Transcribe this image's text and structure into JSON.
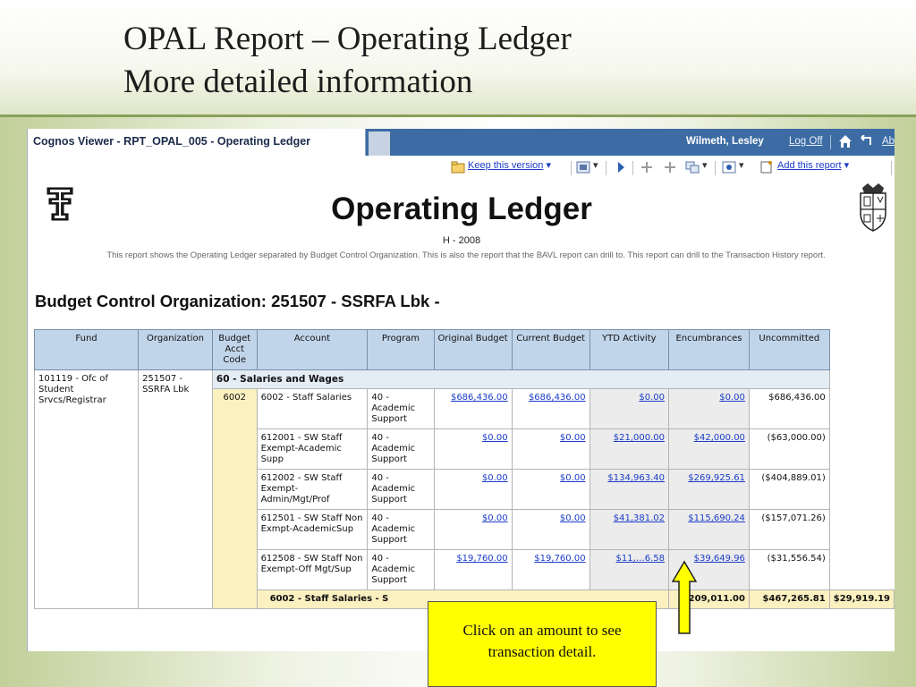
{
  "slide": {
    "title_line1": "OPAL Report – Operating Ledger",
    "title_line2": "More detailed information"
  },
  "viewer": {
    "tab_title": "Cognos Viewer - RPT_OPAL_005 - Operating Ledger",
    "user": "Wilmeth, Lesley",
    "logoff": "Log Off",
    "about_partial": "Ab",
    "toolbar": {
      "keep_version": "Keep this version",
      "add_report": "Add this report"
    }
  },
  "report": {
    "title": "Operating Ledger",
    "subtitle": "H - 2008",
    "description": "This report shows the Operating Ledger separated by Budget Control Organization.  This is also the report that the BAVL report can drill to.  This report can drill to the Transaction History report.",
    "bco_heading": "Budget Control Organization: 251507 - SSRFA Lbk -"
  },
  "table": {
    "headers": {
      "fund": "Fund",
      "organization": "Organization",
      "budget_acct_code": "Budget Acct Code",
      "account": "Account",
      "program": "Program",
      "original_budget": "Original Budget",
      "current_budget": "Current Budget",
      "ytd_activity": "YTD Activity",
      "encumbrances": "Encumbrances",
      "uncommitted": "Uncommitted"
    },
    "fund": "101119 - Ofc of Student Srvcs/Registrar",
    "organization": "251507 - SSRFA Lbk",
    "group_label": "60 - Salaries and Wages",
    "budget_acct_code": "6002",
    "rows": [
      {
        "account": "6002 - Staff Salaries",
        "program": "40 - Academic Support",
        "original": "$686,436.00",
        "current": "$686,436.00",
        "ytd": "$0.00",
        "enc": "$0.00",
        "uncommitted": "$686,436.00"
      },
      {
        "account": "612001 - SW Staff Exempt-Academic Supp",
        "program": "40 - Academic Support",
        "original": "$0.00",
        "current": "$0.00",
        "ytd": "$21,000.00",
        "enc": "$42,000.00",
        "uncommitted": "($63,000.00)"
      },
      {
        "account": "612002 - SW Staff Exempt-Admin/Mgt/Prof",
        "program": "40 - Academic Support",
        "original": "$0.00",
        "current": "$0.00",
        "ytd": "$134,963.40",
        "enc": "$269,925.61",
        "uncommitted": "($404,889.01)"
      },
      {
        "account": "612501 - SW Staff Non Exmpt-AcademicSup",
        "program": "40 - Academic Support",
        "original": "$0.00",
        "current": "$0.00",
        "ytd": "$41,381.02",
        "enc": "$115,690.24",
        "uncommitted": "($157,071.26)"
      },
      {
        "account": "612508 - SW Staff Non Exempt-Off Mgt/Sup",
        "program": "40 - Academic Support",
        "original": "$19,760.00",
        "current": "$19,760.00",
        "ytd": "$11,…6.58",
        "enc": "$39,649.96",
        "uncommitted": "($31,556.54)"
      }
    ],
    "total": {
      "label": "6002 - Staff Salaries - S",
      "ytd": "209,011.00",
      "enc": "$467,265.81",
      "uncommitted": "$29,919.19"
    }
  },
  "callout": {
    "text": "Click on an amount to see transaction detail."
  },
  "colors": {
    "accent": "#3d6ca4",
    "header_fill": "#c1d5ea",
    "callout": "#ffff00",
    "link": "#1a3cc8"
  }
}
